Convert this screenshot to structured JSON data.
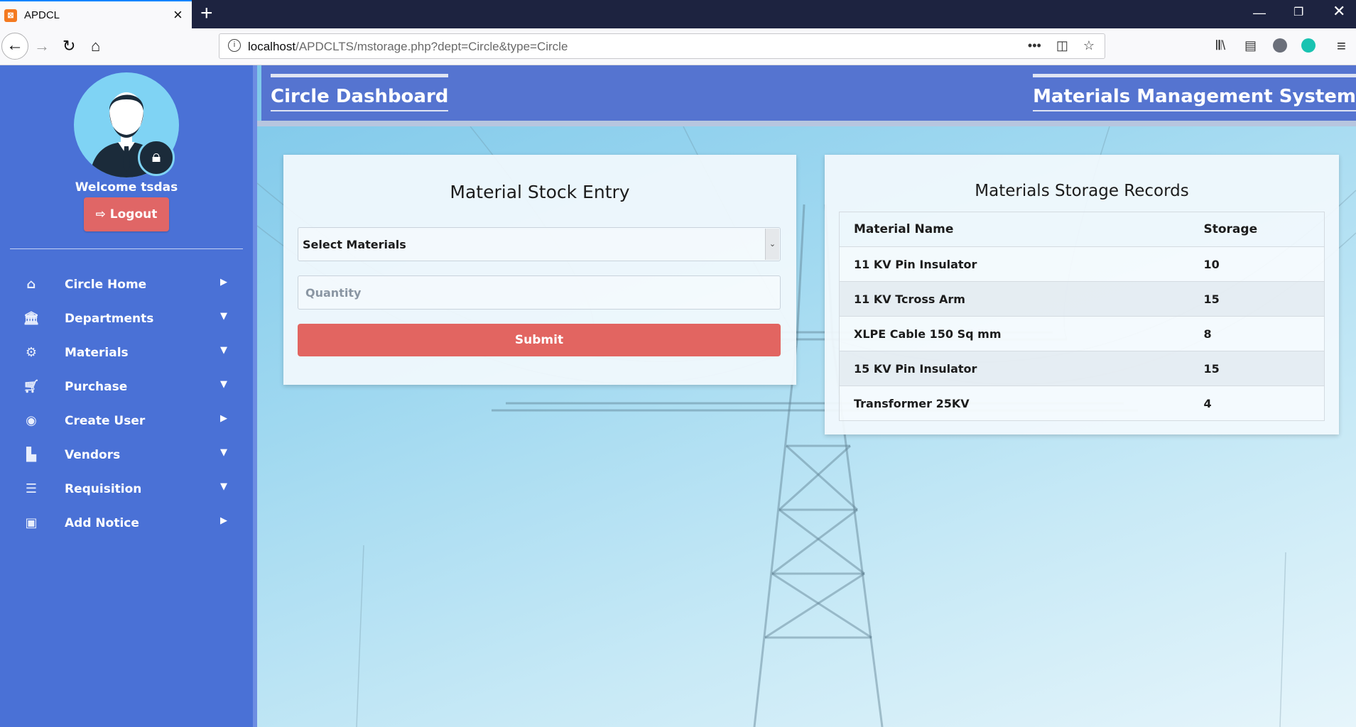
{
  "browser": {
    "tab_title": "APDCL",
    "tab_favicon": "xampp-icon",
    "url_host": "localhost",
    "url_path": "/APDCLTS/mstorage.php?dept=Circle&type=Circle"
  },
  "sidebar": {
    "welcome": "Welcome tsdas",
    "logout_label": "Logout",
    "items": [
      {
        "label": "Circle Home",
        "icon": "home-icon",
        "caret": "right"
      },
      {
        "label": "Departments",
        "icon": "bank-icon",
        "caret": "down"
      },
      {
        "label": "Materials",
        "icon": "gears-icon",
        "caret": "down"
      },
      {
        "label": "Purchase",
        "icon": "cart-icon",
        "caret": "down"
      },
      {
        "label": "Create User",
        "icon": "user-circle-icon",
        "caret": "right"
      },
      {
        "label": "Vendors",
        "icon": "industry-icon",
        "caret": "down"
      },
      {
        "label": "Requisition",
        "icon": "list-icon",
        "caret": "down"
      },
      {
        "label": "Add Notice",
        "icon": "newspaper-icon",
        "caret": "right"
      }
    ]
  },
  "header": {
    "left_title": "Circle Dashboard",
    "right_title": "Materials Management System"
  },
  "stock_entry": {
    "title": "Material Stock Entry",
    "select_value": "Select Materials",
    "quantity_placeholder": "Quantity",
    "submit_label": "Submit"
  },
  "records": {
    "title": "Materials Storage Records",
    "columns": [
      "Material Name",
      "Storage"
    ],
    "rows": [
      [
        "11 KV Pin Insulator",
        "10"
      ],
      [
        "11 KV Tcross Arm",
        "15"
      ],
      [
        "XLPE Cable 150 Sq mm",
        "8"
      ],
      [
        "15 KV Pin Insulator",
        "15"
      ],
      [
        "Transformer 25KV",
        "4"
      ]
    ]
  },
  "colors": {
    "sidebar": "#4a71d6",
    "header": "#5574d0",
    "accent_red": "#e26561"
  }
}
